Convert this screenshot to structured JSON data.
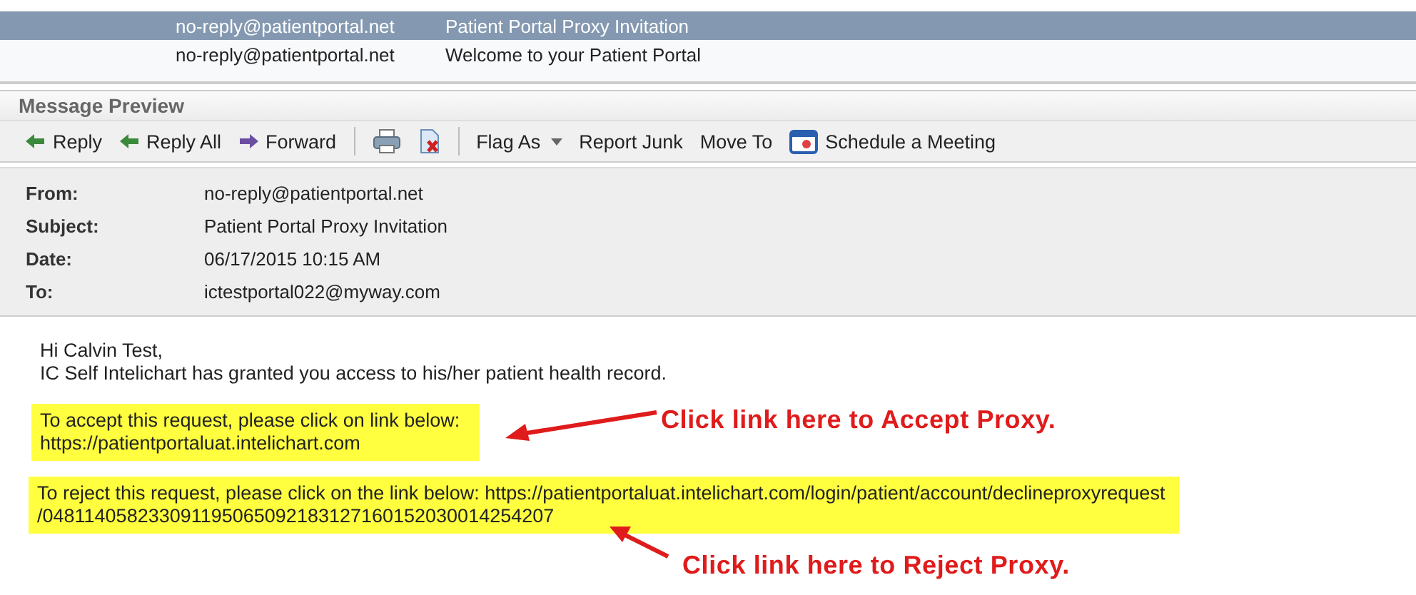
{
  "message_list": [
    {
      "from": "no-reply@patientportal.net",
      "subject": "Patient Portal Proxy Invitation",
      "selected": true
    },
    {
      "from": "no-reply@patientportal.net",
      "subject": "Welcome to your Patient Portal",
      "selected": false
    }
  ],
  "preview_title": "Message Preview",
  "toolbar": [
    {
      "kind": "reply",
      "label": "Reply"
    },
    {
      "kind": "reply",
      "label": "Reply All"
    },
    {
      "kind": "forward",
      "label": "Forward"
    },
    {
      "kind": "separator"
    },
    {
      "kind": "print"
    },
    {
      "kind": "delete"
    },
    {
      "kind": "separator"
    },
    {
      "kind": "dropdown",
      "label": "Flag As"
    },
    {
      "kind": "plain",
      "label": "Report Junk"
    },
    {
      "kind": "plain",
      "label": "Move To"
    },
    {
      "kind": "calendar",
      "label": "Schedule a Meeting"
    }
  ],
  "headers": [
    {
      "label": "From:",
      "value": "no-reply@patientportal.net"
    },
    {
      "label": "Subject:",
      "value": "Patient Portal Proxy Invitation"
    },
    {
      "label": "Date:",
      "value": "06/17/2015 10:15 AM"
    },
    {
      "label": "To:",
      "value": "ictestportal022@myway.com"
    }
  ],
  "body": {
    "greeting": "Hi Calvin Test,",
    "intro": "IC Self Intelichart has granted you access to his/her patient health record.",
    "accept": {
      "lines": [
        "To accept this request, please click on link below:",
        "https://patientportaluat.intelichart.com"
      ],
      "highlighted": true
    },
    "reject": {
      "lines": [
        "To reject this request, please click on the link below: https://patientportaluat.intelichart.com/login/patient/account/declineproxyrequest",
        "/048114058233091195065092183127160152030014254207"
      ],
      "highlighted": true
    }
  },
  "annotations": [
    {
      "text": "Click link here to Accept Proxy."
    },
    {
      "text": "Click link here to Reject Proxy."
    }
  ]
}
